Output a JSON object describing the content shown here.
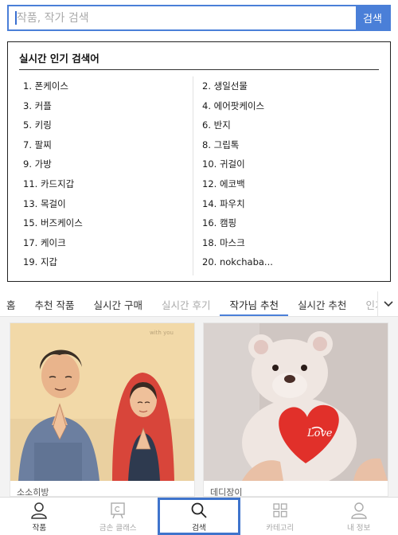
{
  "search": {
    "placeholder": "작품, 작가 검색",
    "button_label": "검색"
  },
  "popular": {
    "title": "실시간 인기 검색어",
    "left": [
      "1. 폰케이스",
      "3. 커플",
      "5. 키링",
      "7. 팔찌",
      "9. 가방",
      "11. 카드지갑",
      "13. 목걸이",
      "15. 버즈케이스",
      "17. 케이크",
      "19. 지갑"
    ],
    "right": [
      "2. 생일선물",
      "4. 에어팟케이스",
      "6. 반지",
      "8. 그립톡",
      "10. 귀걸이",
      "12. 에코백",
      "14. 파우치",
      "16. 캠핑",
      "18. 마스크",
      "20. nokchaba..."
    ]
  },
  "tabs": [
    "홈",
    "추천 작품",
    "실시간 구매",
    "실시간 후기",
    "작가님 추천",
    "실시간 추천",
    "인기 작"
  ],
  "cards": [
    {
      "title": "소소히방",
      "caption": "with you"
    },
    {
      "title": "데디장이",
      "caption": "Love"
    }
  ],
  "nav": [
    "작품",
    "금손 클래스",
    "검색",
    "카테고리",
    "내 정보"
  ],
  "colors": {
    "accent": "#4a7fd8",
    "nav_highlight": "#3f74cc"
  }
}
